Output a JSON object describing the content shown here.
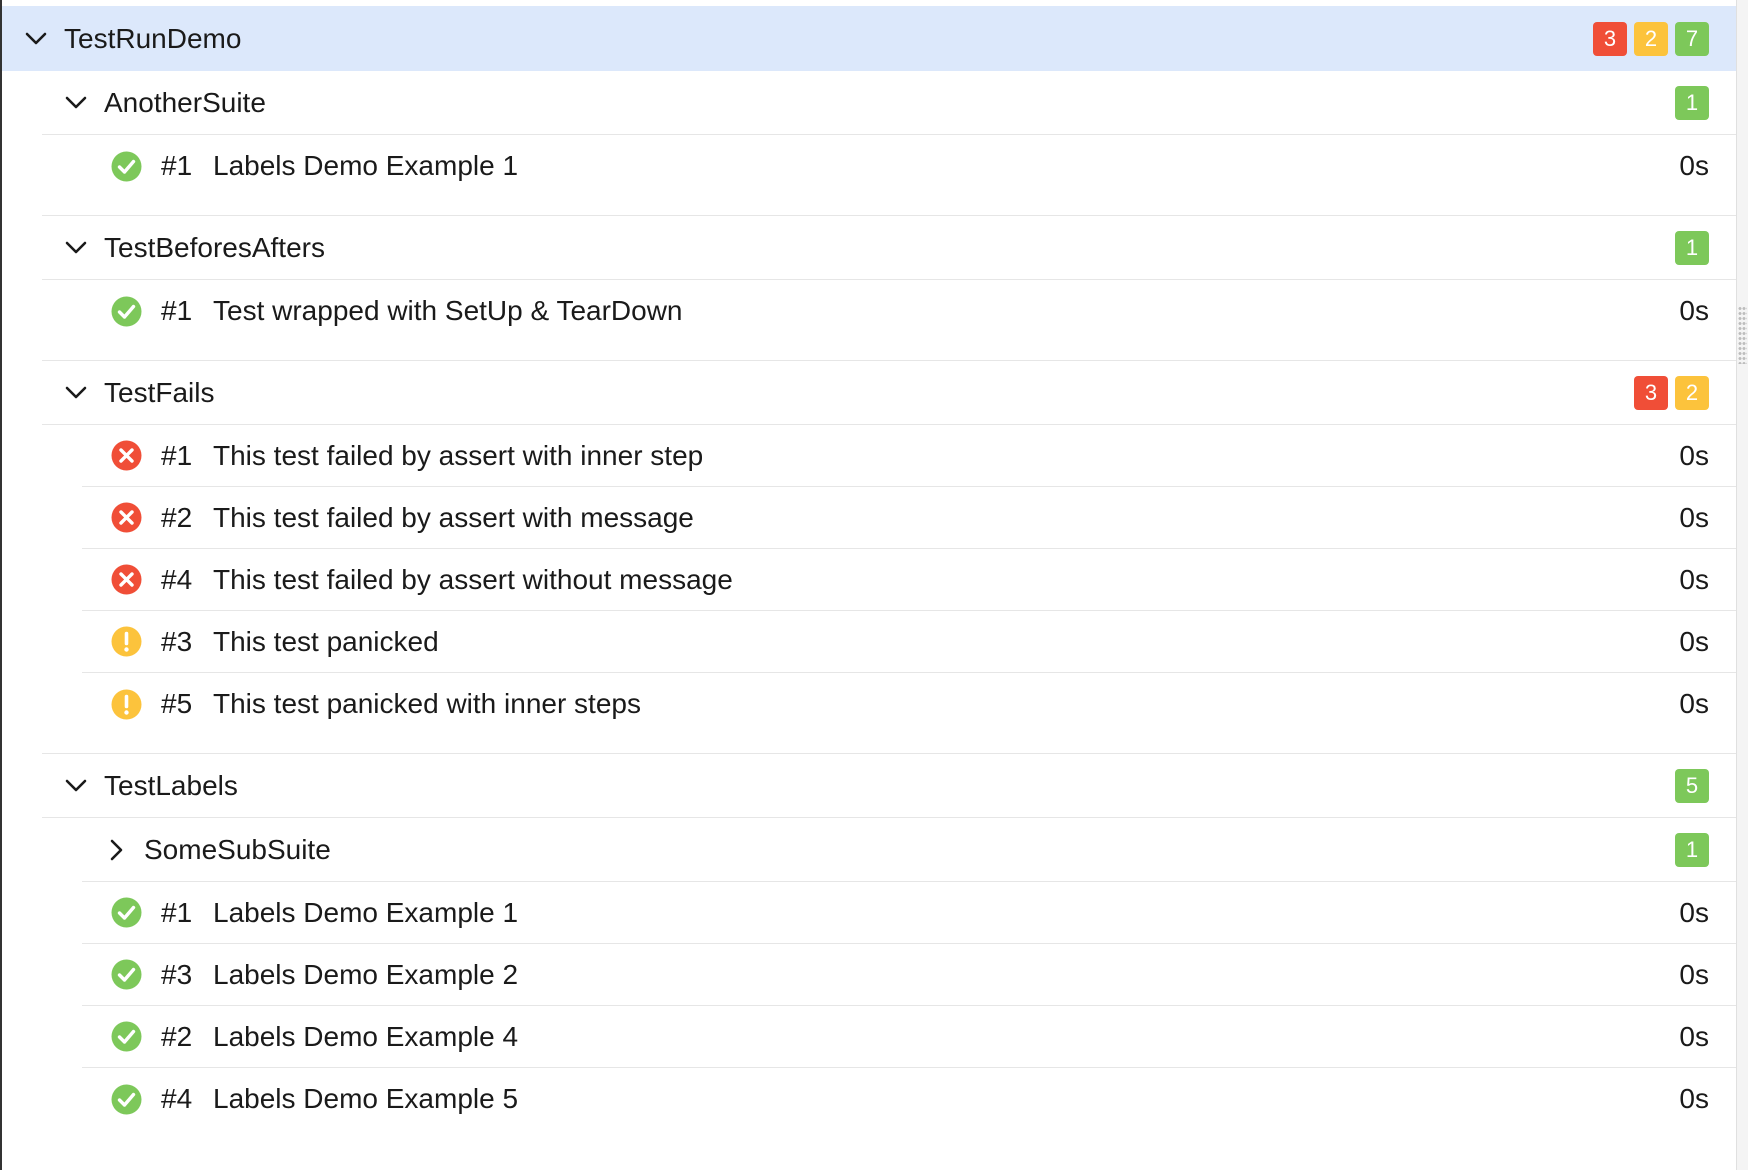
{
  "colors": {
    "failed": "#f04e37",
    "broken": "#fcc33c",
    "passed": "#7dc85a",
    "selected_row": "#dce8fb"
  },
  "root": {
    "name": "TestRunDemo",
    "counts": {
      "failed": "3",
      "broken": "2",
      "passed": "7"
    }
  },
  "suites": {
    "another_suite": {
      "name": "AnotherSuite",
      "counts": {
        "passed": "1"
      },
      "tests": [
        {
          "num": "#1",
          "name": "Labels Demo Example 1",
          "duration": "0s",
          "status": "passed"
        }
      ]
    },
    "befores_afters": {
      "name": "TestBeforesAfters",
      "counts": {
        "passed": "1"
      },
      "tests": [
        {
          "num": "#1",
          "name": "Test wrapped with SetUp & TearDown",
          "duration": "0s",
          "status": "passed"
        }
      ]
    },
    "fails": {
      "name": "TestFails",
      "counts": {
        "failed": "3",
        "broken": "2"
      },
      "tests": [
        {
          "num": "#1",
          "name": "This test failed by assert with inner step",
          "duration": "0s",
          "status": "failed"
        },
        {
          "num": "#2",
          "name": "This test failed by assert with message",
          "duration": "0s",
          "status": "failed"
        },
        {
          "num": "#4",
          "name": "This test failed by assert without message",
          "duration": "0s",
          "status": "failed"
        },
        {
          "num": "#3",
          "name": "This test panicked",
          "duration": "0s",
          "status": "broken"
        },
        {
          "num": "#5",
          "name": "This test panicked with inner steps",
          "duration": "0s",
          "status": "broken"
        }
      ]
    },
    "labels": {
      "name": "TestLabels",
      "counts": {
        "passed": "5"
      },
      "subsuite": {
        "name": "SomeSubSuite",
        "counts": {
          "passed": "1"
        }
      },
      "tests": [
        {
          "num": "#1",
          "name": "Labels Demo Example 1",
          "duration": "0s",
          "status": "passed"
        },
        {
          "num": "#3",
          "name": "Labels Demo Example 2",
          "duration": "0s",
          "status": "passed"
        },
        {
          "num": "#2",
          "name": "Labels Demo Example 4",
          "duration": "0s",
          "status": "passed"
        },
        {
          "num": "#4",
          "name": "Labels Demo Example 5",
          "duration": "0s",
          "status": "passed"
        }
      ]
    }
  },
  "icons": {
    "expanded": "chevron-down-icon",
    "collapsed": "chevron-right-icon",
    "passed": "check-circle-icon",
    "failed": "x-circle-icon",
    "broken": "exclamation-circle-icon"
  }
}
